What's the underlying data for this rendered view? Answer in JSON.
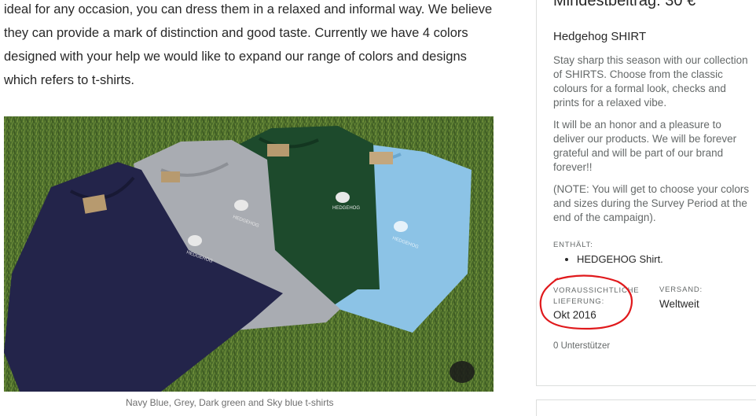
{
  "story": {
    "paragraph_lines": [
      "ideal for any occasion, you can dress them in a relaxed and informal way. We believe",
      "they can provide a mark of distinction and good taste. Currently we have 4 colors",
      "designed with your help we would like to expand our range of colors and designs",
      "which refers to t-shirts."
    ],
    "caption": "Navy Blue, Grey, Dark green and Sky blue t-shirts"
  },
  "photo": {
    "shirt_colors": [
      "#23244a",
      "#a9acb2",
      "#1d4a2c",
      "#8cc3e6"
    ],
    "grass_color": "#4a6b2a",
    "logo_text": "HEDGEHOG"
  },
  "reward": {
    "min_pledge": "Mindestbeitrag: 30 €",
    "title": "Hedgehog SHIRT",
    "description_1_lines": [
      "Stay sharp this season with our collection",
      "of SHIRTS. Choose from the classic",
      "colours for a formal look, checks and",
      "prints for a relaxed vibe."
    ],
    "description_2_lines": [
      "It will be an honor and a pleasure to",
      "deliver our products. We will be forever",
      "grateful and will be part of our brand",
      "forever!!"
    ],
    "description_3_lines": [
      "(NOTE: You will get to choose your colors",
      "and sizes during the Survey Period at the",
      "end of the campaign)."
    ],
    "includes_label": "ENTHÄLT:",
    "includes_items": [
      "HEDGEHOG Shirt."
    ],
    "delivery_label_line1": "VORAUSSICHTLICHE",
    "delivery_label_line2": "LIEFERUNG:",
    "delivery_value": "Okt 2016",
    "shipping_label": "VERSAND:",
    "shipping_value": "Weltweit",
    "backers": "0 Unterstützer"
  },
  "annotation_color": "#e0191c"
}
